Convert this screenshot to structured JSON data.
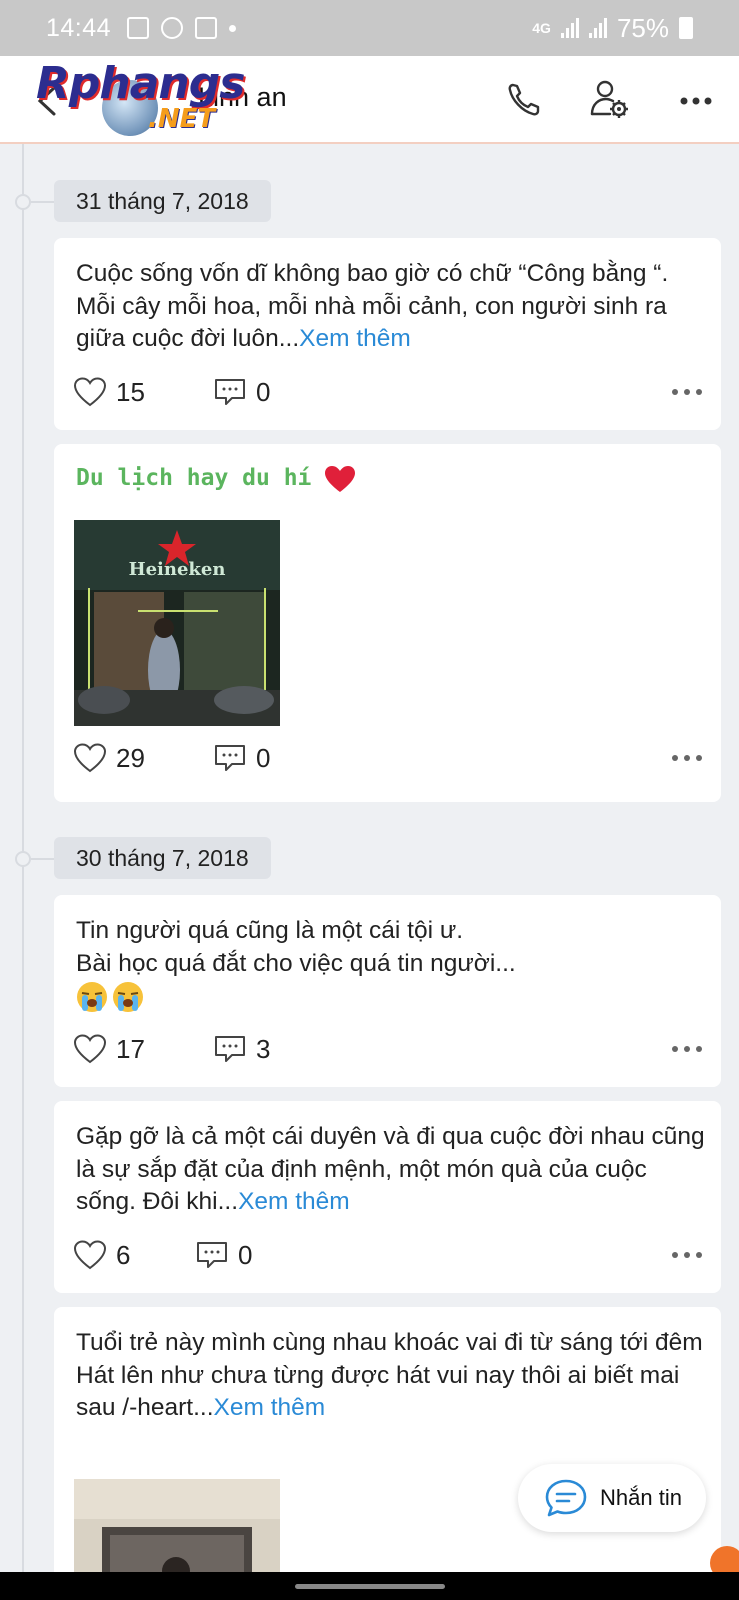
{
  "status_bar": {
    "time": "14:44",
    "network": "4G",
    "battery": "75%"
  },
  "header": {
    "logo_main": "Rphangs",
    "logo_net": ".NET",
    "title": "Linh an"
  },
  "feed": [
    {
      "date": "31 tháng 7, 2018",
      "posts": [
        {
          "text": "Cuộc sống vốn dĩ không bao giờ có chữ “Công bằng “. Mỗi cây mỗi hoa, mỗi nhà mỗi cảnh, con người sinh ra giữa cuộc đời luôn...",
          "more": "Xem thêm",
          "likes": "15",
          "comments": "0"
        },
        {
          "caption": "Du lịch hay du hí",
          "photo_label": "Heineken",
          "likes": "29",
          "comments": "0"
        }
      ]
    },
    {
      "date": "30 tháng 7, 2018",
      "posts": [
        {
          "line1": "Tin người quá cũng là một cái tội ư.",
          "line2": "Bài học quá đắt cho việc quá tin người...",
          "likes": "17",
          "comments": "3"
        },
        {
          "text": "Gặp gỡ là cả một cái duyên và đi qua cuộc đời nhau cũng là sự sắp đặt của định mệnh, một món quà của cuộc sống. Đôi khi...",
          "more": "Xem thêm",
          "likes": "6",
          "comments": "0"
        },
        {
          "line1": "Tuổi trẻ này mình cùng nhau khoác vai đi từ sáng tới đêm",
          "line2": "Hát lên như chưa từng được hát vui nay thôi ai biết mai sau /-heart...",
          "more": "Xem thêm"
        }
      ]
    }
  ],
  "message_button": {
    "label": "Nhắn tin"
  },
  "colors": {
    "accent": "#2a8ad6",
    "green": "#5bb55e",
    "background": "#eef0f3"
  }
}
